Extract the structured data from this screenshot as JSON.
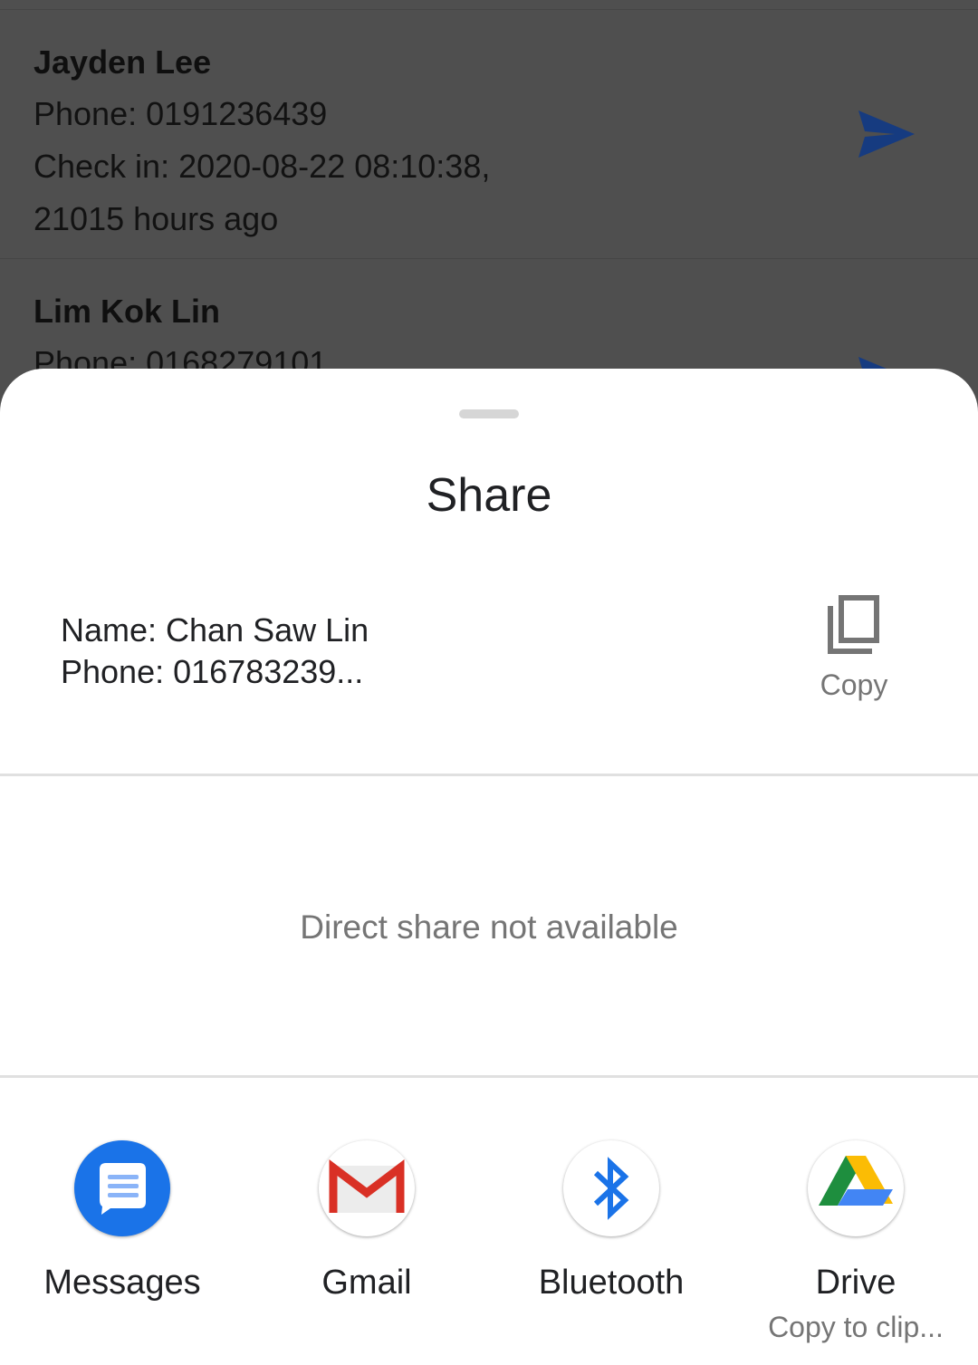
{
  "background": {
    "contacts": [
      {
        "name": "Jayden Lee",
        "phone": "Phone: 0191236439",
        "checkin": "Check in: 2020-08-22 08:10:38,",
        "ago": "21015 hours ago"
      },
      {
        "name": "Lim Kok Lin",
        "phone": "Phone: 0168279101"
      }
    ],
    "send_icon": "send-icon"
  },
  "sheet": {
    "title": "Share",
    "preview": {
      "name_line": "Name: Chan Saw Lin",
      "phone_line": "Phone: 016783239..."
    },
    "copy": {
      "label": "Copy",
      "icon": "copy-icon"
    },
    "direct_share_message": "Direct share not available",
    "apps": [
      {
        "label": "Messages",
        "icon": "messages-icon"
      },
      {
        "label": "Gmail",
        "icon": "gmail-icon"
      },
      {
        "label": "Bluetooth",
        "icon": "bluetooth-icon"
      },
      {
        "label": "Drive",
        "sublabel": "Copy to clip...",
        "icon": "drive-icon"
      }
    ]
  },
  "colors": {
    "send_arrow": "#163b80",
    "messages_blue": "#1a73e8",
    "gmail_red": "#d93025",
    "bluetooth_blue": "#1a73e8",
    "drive_green": "#1e8e3e",
    "drive_yellow": "#fbbc04",
    "drive_blue": "#4285f4"
  }
}
